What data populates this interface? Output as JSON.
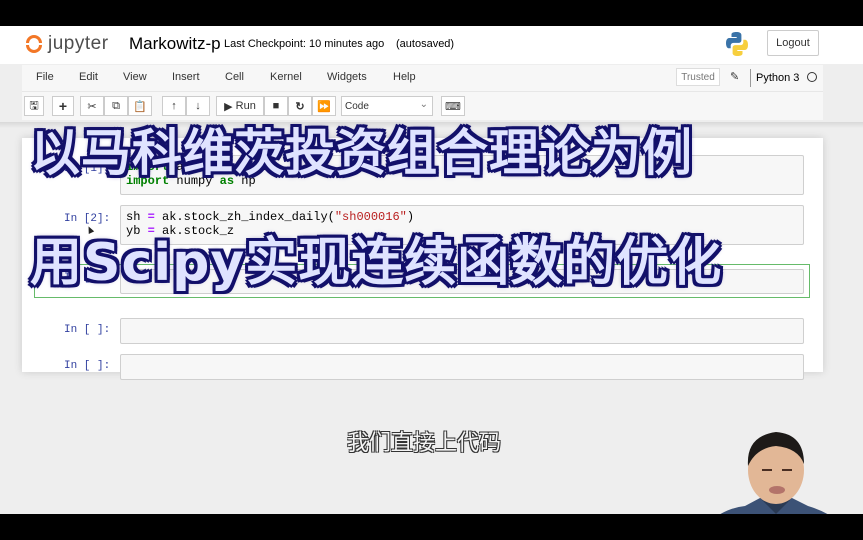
{
  "header": {
    "logo_text": "jupyter",
    "notebook_name": "Markowitz-p",
    "checkpoint": "Last Checkpoint: 10 minutes ago",
    "autosave": "(autosaved)",
    "logout_label": "Logout"
  },
  "menubar": {
    "items": [
      "File",
      "Edit",
      "View",
      "Insert",
      "Cell",
      "Kernel",
      "Widgets",
      "Help"
    ],
    "trusted": "Trusted",
    "kernel_name": "Python 3"
  },
  "toolbar": {
    "run_label": "Run",
    "cell_type": "Code"
  },
  "cells": [
    {
      "prompt": "In [1]:",
      "lines": [
        "import akshare as ak",
        "import numpy as np"
      ]
    },
    {
      "prompt": "In [2]:",
      "lines": [
        "sh = ak.stock_zh_index_daily(\"sh000016\")",
        "yb = ak.stock_zh_index_daily(...)"
      ]
    },
    {
      "prompt": "In [ ]:",
      "lines": [
        ""
      ]
    },
    {
      "prompt": "In [ ]:",
      "lines": [
        ""
      ]
    },
    {
      "prompt": "In [ ]:",
      "lines": [
        ""
      ]
    }
  ],
  "code": {
    "c1_kw1": "import",
    "c1_rest1": " akshare ",
    "c1_kw1b": "as",
    "c1_rest1b": " ak",
    "c1_kw2": "import",
    "c1_rest2": " numpy ",
    "c1_kw2b": "as",
    "c1_rest2b": " np",
    "c2_l1a": "sh ",
    "c2_l1op": "=",
    "c2_l1b": " ak.stock_zh_index_daily(",
    "c2_l1str": "\"sh000016\"",
    "c2_l1c": ")",
    "c2_l2a": "yb ",
    "c2_l2op": "=",
    "c2_l2b": " ak.stock_z"
  },
  "overlay": {
    "title_line1": "以马科维茨投资组合理论为例",
    "title_line2": "用Scipy实现连续函数的优化",
    "subtitle": "我们直接上代码"
  }
}
